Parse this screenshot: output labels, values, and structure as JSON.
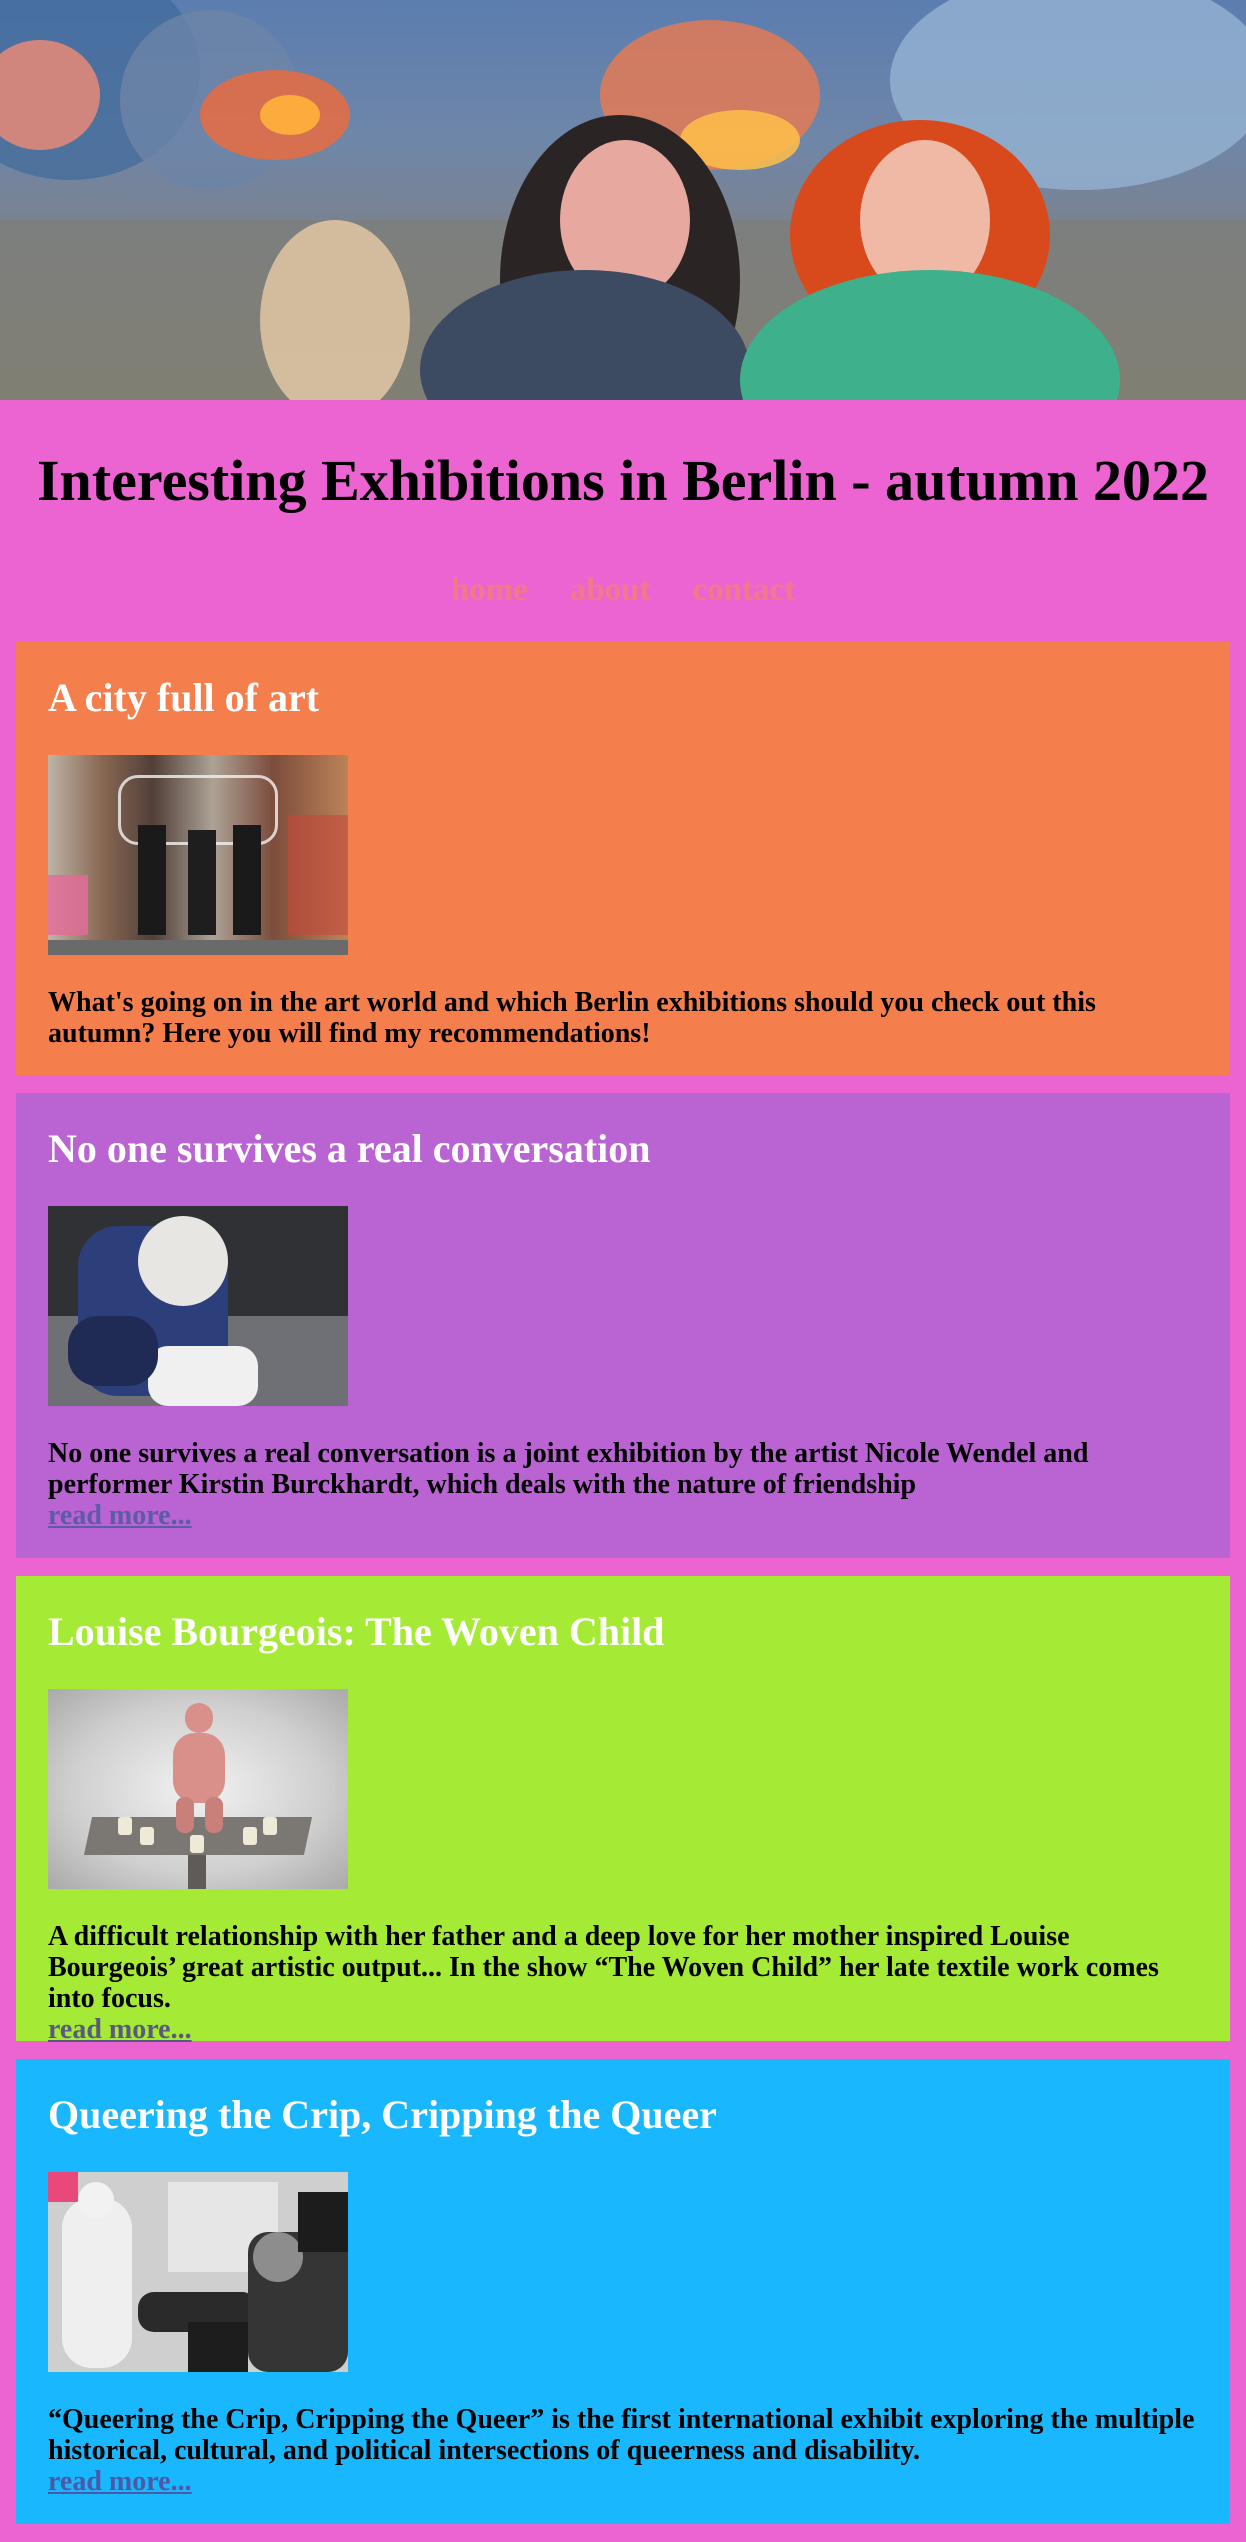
{
  "header": {
    "title": "Interesting Exhibitions in Berlin - autumn 2022",
    "hero_image": "hero-painting"
  },
  "nav": {
    "items": [
      {
        "label": "home"
      },
      {
        "label": "about"
      },
      {
        "label": "contact"
      }
    ]
  },
  "articles": [
    {
      "title": "A city full of art",
      "image": "street-art-photo",
      "text": "What's going on in the art world and which Berlin exhibitions should you check out this autumn? Here you will find my recommendations!",
      "link": ""
    },
    {
      "title": "No one survives a real conversation",
      "image": "performers-embrace-photo",
      "text": "No one survives a real conversation is a joint exhibition by the artist Nicole Wendel and performer Kirstin Burckhardt, which deals with the nature of friendship",
      "link": "read more..."
    },
    {
      "title": "Louise Bourgeois: The Woven Child",
      "image": "textile-sculpture-photo",
      "text": "A difficult relationship with her father and a deep love for her mother inspired Louise Bourgeois’ great artistic output... In the show “The Woven Child” her late textile work comes into focus.",
      "link": "read more..."
    },
    {
      "title": "Queering the Crip, Cripping the Queer",
      "image": "exhibition-visitors-photo",
      "text": "“Queering the Crip, Cripping the Queer” is the first international exhibit exploring the multiple historical, cultural, and political intersections of queerness and disability.",
      "link": "read more..."
    }
  ],
  "colors": {
    "page_background": "#ec64d2",
    "card1": "#f47e4c",
    "card2": "#b964d2",
    "card3": "#a5ea34",
    "card4": "#19b7fd",
    "nav_link": "#f07a8a",
    "card_title": "#ffffff"
  }
}
